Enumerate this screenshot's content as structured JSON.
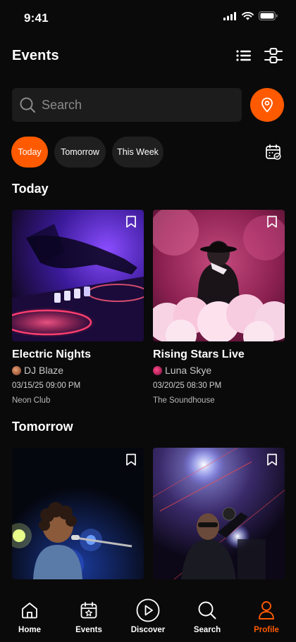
{
  "status_bar": {
    "time": "9:41"
  },
  "header": {
    "title": "Events",
    "list_icon": "list-icon",
    "filter_icon": "sliders-icon"
  },
  "search": {
    "placeholder": "Search",
    "value": "",
    "location_icon": "map-pin-icon"
  },
  "filters": {
    "chips": [
      {
        "label": "Today",
        "active": true
      },
      {
        "label": "Tomorrow",
        "active": false
      },
      {
        "label": "This Week",
        "active": false
      }
    ],
    "calendar_icon": "calendar-check-icon"
  },
  "sections": [
    {
      "title": "Today",
      "events": [
        {
          "title": "Electric Nights",
          "artist": "DJ Blaze",
          "datetime": "03/15/25 09:00 PM",
          "venue": "Neon Club"
        },
        {
          "title": "Rising Stars Live",
          "artist": "Luna Skye",
          "datetime": "03/20/25 08:30 PM",
          "venue": "The Soundhouse"
        }
      ]
    },
    {
      "title": "Tomorrow",
      "events": [
        {},
        {}
      ]
    }
  ],
  "nav": {
    "items": [
      {
        "label": "Home",
        "icon": "home-icon",
        "active": false
      },
      {
        "label": "Events",
        "icon": "calendar-star-icon",
        "active": false
      },
      {
        "label": "Discover",
        "icon": "play-circle-icon",
        "active": false
      },
      {
        "label": "Search",
        "icon": "search-icon",
        "active": false
      },
      {
        "label": "Profile",
        "icon": "user-icon",
        "active": true
      }
    ]
  },
  "colors": {
    "accent": "#ff5a00",
    "background": "#0a0a0a",
    "surface": "#1c1c1c"
  }
}
